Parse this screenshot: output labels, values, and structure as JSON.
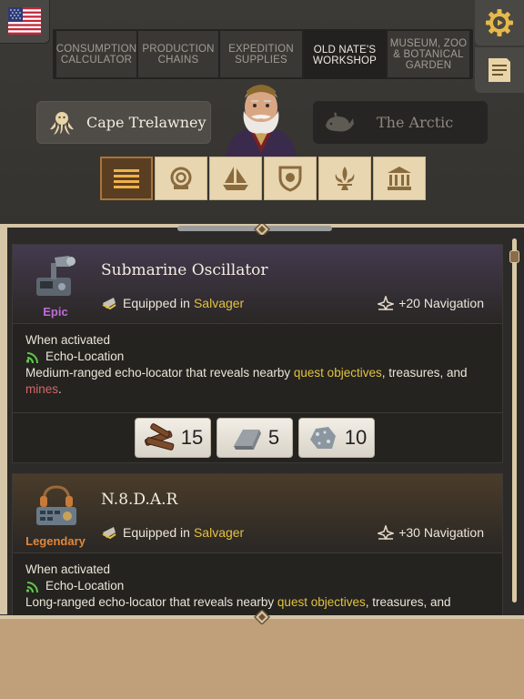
{
  "language": {
    "flag_icon": "us-flag-icon"
  },
  "tabs": [
    {
      "line1": "CONSUMPTION",
      "line2": "CALCULATOR",
      "line3": ""
    },
    {
      "line1": "PRODUCTION",
      "line2": "CHAINS",
      "line3": ""
    },
    {
      "line1": "EXPEDITION",
      "line2": "SUPPLIES",
      "line3": ""
    },
    {
      "line1": "OLD NATE'S",
      "line2": "WORKSHOP",
      "line3": ""
    },
    {
      "line1": "MUSEUM, ZOO",
      "line2": "& BOTANICAL",
      "line3": "GARDEN"
    }
  ],
  "active_tab": "OLD NATE'S WORKSHOP",
  "header_buttons": {
    "settings_icon": "gear-play-icon",
    "notes_icon": "document-icon"
  },
  "areas": {
    "left": {
      "label": "Cape Trelawney",
      "icon": "octopus-icon"
    },
    "right": {
      "label": "The Arctic",
      "icon": "whale-icon"
    }
  },
  "filters": [
    "list-icon",
    "diving-helmet-icon",
    "ship-icon",
    "shield-icon",
    "fleur-de-lis-icon",
    "museum-icon"
  ],
  "items": [
    {
      "name": "Submarine Oscillator",
      "rarity": "Epic",
      "rarity_color": "#c06bd8",
      "equipped_prefix": "Equipped in",
      "equipped_ship": "Salvager",
      "stat": "+20 Navigation",
      "trigger": "When activated",
      "ability": "Echo-Location",
      "desc_start": "Medium-ranged echo-locator that reveals nearby ",
      "desc_hl1": "quest objectives",
      "desc_mid": ", treasures, and",
      "desc_hl2": "mines",
      "desc_end": ".",
      "costs": [
        {
          "icon": "timber-icon",
          "value": "15"
        },
        {
          "icon": "steel-ingot-icon",
          "value": "5"
        },
        {
          "icon": "ore-icon",
          "value": "10"
        }
      ]
    },
    {
      "name": "N.8.D.A.R",
      "rarity": "Legendary",
      "rarity_color": "#e0873a",
      "equipped_prefix": "Equipped in",
      "equipped_ship": "Salvager",
      "stat": "+30 Navigation",
      "trigger": "When activated",
      "ability": "Echo-Location",
      "desc_start": "Long-ranged echo-locator that reveals nearby ",
      "desc_hl1": "quest objectives",
      "desc_mid": ", treasures, and"
    }
  ]
}
